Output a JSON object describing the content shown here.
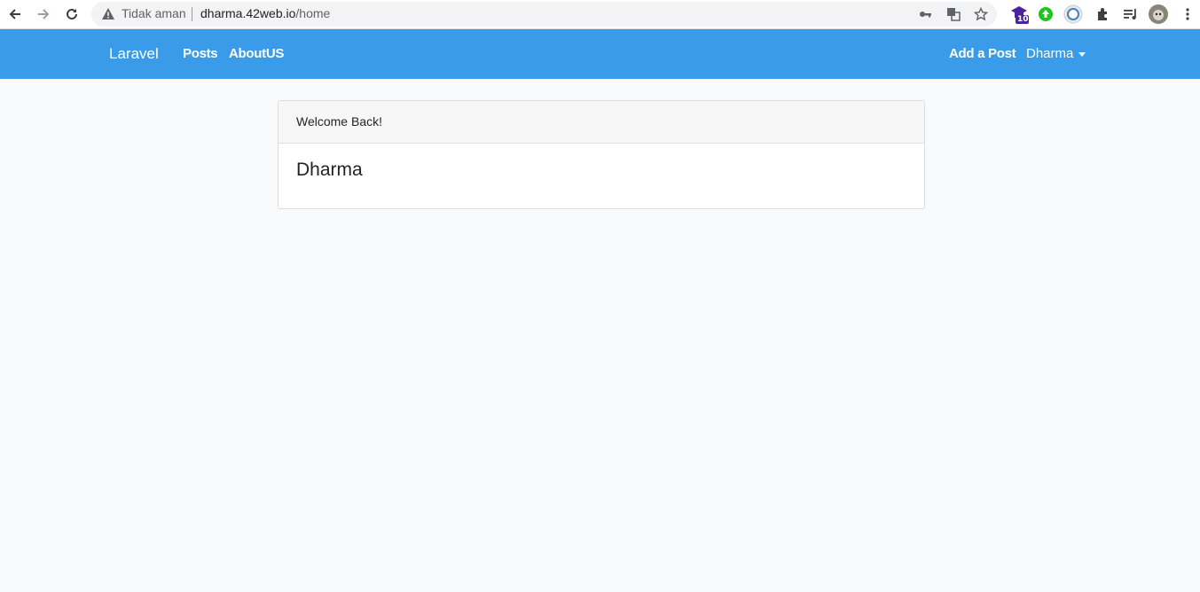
{
  "browser": {
    "security_label": "Tidak aman",
    "url_host": "dharma.42web.io",
    "url_path": "/home",
    "extension_badge": "10"
  },
  "navbar": {
    "brand": "Laravel",
    "links": [
      {
        "label": "Posts"
      },
      {
        "label": "AboutUS"
      }
    ],
    "add_post": "Add a Post",
    "user": "Dharma"
  },
  "card": {
    "header": "Welcome Back!",
    "title": "Dharma"
  },
  "colors": {
    "navbar": "#3a9be8",
    "page_bg": "#f8fafc"
  }
}
